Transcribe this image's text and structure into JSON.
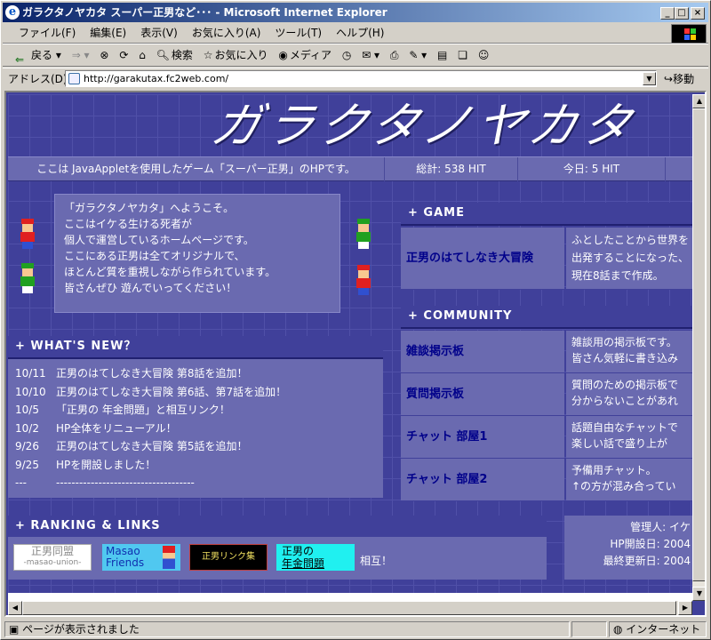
{
  "window": {
    "title": "ガラクタノヤカタ スーパー正男など･･･ - Microsoft Internet Explorer",
    "minimize": "_",
    "maximize": "□",
    "close": "×"
  },
  "menu": [
    "ファイル(F)",
    "編集(E)",
    "表示(V)",
    "お気に入り(A)",
    "ツール(T)",
    "ヘルプ(H)"
  ],
  "toolbar": {
    "back": "戻る",
    "search": "検索",
    "favorites": "お気に入り",
    "media": "メディア"
  },
  "address": {
    "label": "アドレス(D)",
    "url": "http://garakutax.fc2web.com/",
    "go": "移動"
  },
  "site": {
    "logo": "ガラクタノヤカタ",
    "info": {
      "description": "ここは JavaAppletを使用したゲーム「スーパー正男」のHPです。",
      "total": "総計: 538 HIT",
      "today": "今日: 5 HIT"
    },
    "welcome": [
      "「ガラクタノヤカタ」へようこそ。",
      "ここはイケる生ける死者が",
      "個人で運営しているホームページです。",
      "ここにある正男は全てオリジナルで、",
      "ほとんど質を重視しながら作られています。",
      "皆さんぜひ 遊んでいってください！"
    ],
    "game_header": "+ GAME",
    "game_rows": [
      {
        "title": "正男のはてしなき大冒険",
        "desc1": "ふとしたことから世界を",
        "desc2": "出発することになった、",
        "desc3": "現在8話まで作成。"
      }
    ],
    "community_header": "+ COMMUNITY",
    "community_rows": [
      {
        "title": "雑談掲示板",
        "desc1": "雑談用の掲示板です。",
        "desc2": "皆さん気軽に書き込み"
      },
      {
        "title": "質問掲示板",
        "desc1": "質問のための掲示板で",
        "desc2": "分からないことがあれ"
      },
      {
        "title": "チャット 部屋1",
        "desc1": "話題自由なチャットで",
        "desc2": "楽しい話で盛り上が"
      },
      {
        "title": "チャット 部屋2",
        "desc1": "予備用チャット。",
        "desc2": "↑の方が混み合ってい"
      }
    ],
    "news_header": "+ WHAT'S NEW？",
    "news": [
      {
        "date": "10/11",
        "text": "正男のはてしなき大冒険 第8話を追加！"
      },
      {
        "date": "10/10",
        "text": "正男のはてしなき大冒険 第6話、第7話を追加！"
      },
      {
        "date": "10/5",
        "text": "「正男の 年金問題」と相互リンク！"
      },
      {
        "date": "10/2",
        "text": "HP全体をリニューアル！"
      },
      {
        "date": "9/26",
        "text": "正男のはてしなき大冒険 第5話を追加！"
      },
      {
        "date": "9/25",
        "text": "HPを開設しました！"
      },
      {
        "date": "---",
        "text": "------------------------------------"
      }
    ],
    "rank_header": "+ RANKING & LINKS",
    "banners": {
      "b1_line1": "正男同盟",
      "b1_line2": "-masao-union-",
      "b2_line1": "Masao",
      "b2_line2": "Friends",
      "b3": "正男リンク集",
      "b4_line1": "正男の",
      "b4_line2": "年金問題",
      "mutual": "相互！"
    },
    "admin": {
      "manager": "管理人: イケ",
      "opened": "HP開設日: 2004",
      "updated": "最終更新日: 2004"
    }
  },
  "status": {
    "text": "ページが表示されました",
    "zone": "インターネット"
  }
}
